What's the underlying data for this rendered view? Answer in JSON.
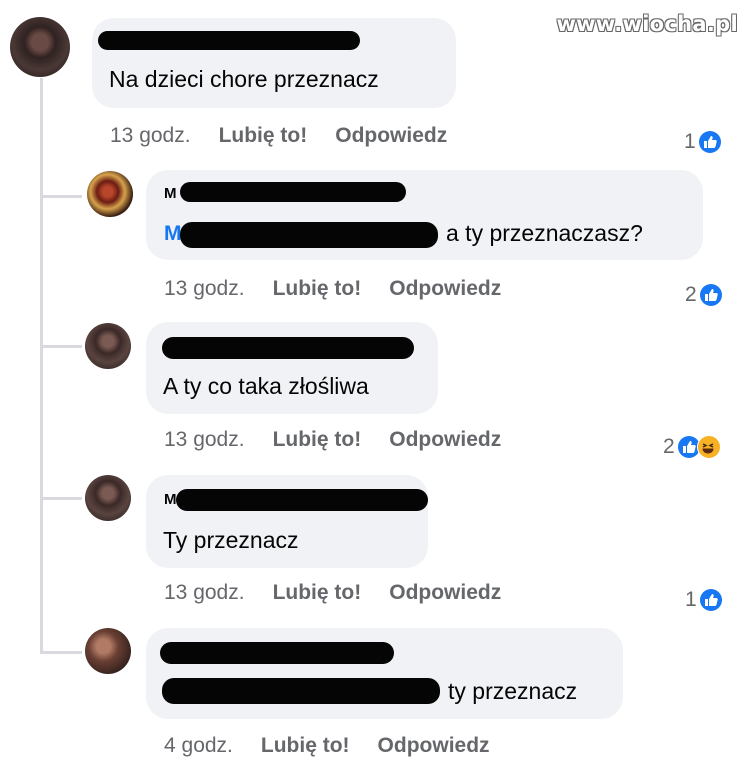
{
  "watermark": "www.wiocha.pl",
  "comments": [
    {
      "name_fragment": "",
      "text": "Na dzieci chore przeznacz",
      "time": "13 godz.",
      "like_label": "Lubię to!",
      "reply_label": "Odpowiedz",
      "reaction_count": "1",
      "reactions": [
        "like-icon"
      ]
    },
    {
      "name_fragment": "M",
      "mention_fragment": "M",
      "text": "a ty przeznaczasz?",
      "time": "13 godz.",
      "like_label": "Lubię to!",
      "reply_label": "Odpowiedz",
      "reaction_count": "2",
      "reactions": [
        "like-icon"
      ]
    },
    {
      "name_fragment": "",
      "text": "A ty co taka złośliwa",
      "time": "13 godz.",
      "like_label": "Lubię to!",
      "reply_label": "Odpowiedz",
      "reaction_count": "2",
      "reactions": [
        "like-icon",
        "haha-icon"
      ]
    },
    {
      "name_fragment": "M",
      "text": "Ty przeznacz",
      "time": "13 godz.",
      "like_label": "Lubię to!",
      "reply_label": "Odpowiedz",
      "reaction_count": "1",
      "reactions": [
        "like-icon"
      ]
    },
    {
      "name_fragment": "",
      "text": "ty przeznacz",
      "time": "4 godz.",
      "like_label": "Lubię to!",
      "reply_label": "Odpowiedz",
      "reaction_count": "",
      "reactions": []
    }
  ],
  "colors": {
    "bubble": "#f0f2f5",
    "meta_text": "#65676b",
    "mention": "#1877f2",
    "like_badge": "#1877f2",
    "haha_badge": "#f7b125"
  }
}
